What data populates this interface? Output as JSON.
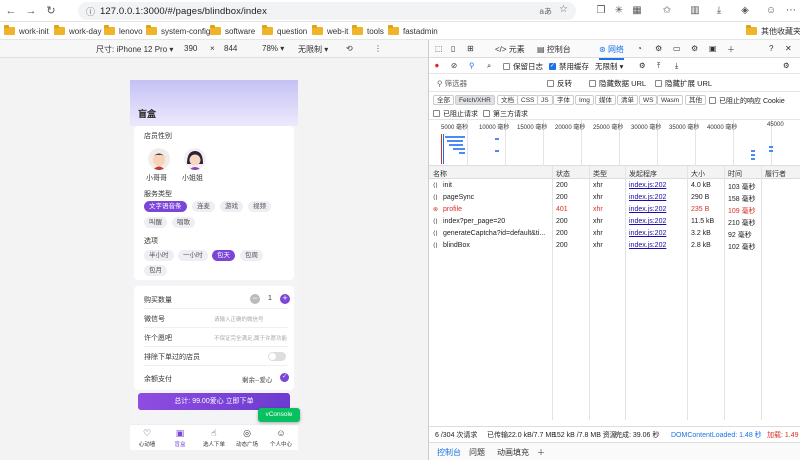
{
  "browser": {
    "url": "127.0.0.1:3000/#/pages/blindbox/index",
    "translate": "aあ",
    "bookmarks": [
      "work-init",
      "work-day",
      "lenovo",
      "system-config",
      "software",
      "question",
      "web-it",
      "tools",
      "fastadmin"
    ],
    "other_bookmarks": "其他收藏夹"
  },
  "device_toolbar": {
    "size_label": "尺寸: iPhone 12 Pro ▾",
    "width": "390",
    "x": "×",
    "height": "844",
    "zoom": "78% ▾",
    "throttle": "无限制 ▾"
  },
  "app": {
    "title": "盲盒",
    "gender_section": "店员性别",
    "genders": [
      {
        "label": "小哥哥"
      },
      {
        "label": "小姐姐"
      }
    ],
    "service_section": "服务类型",
    "services": [
      "文字语音条",
      "连麦",
      "游戏",
      "视频",
      "叫醒",
      "唱歌"
    ],
    "option_section": "选项",
    "options": [
      "半小时",
      "一小时",
      "包天",
      "包周",
      "包月"
    ],
    "quantity_label": "购买数量",
    "quantity_value": "1",
    "wechat_label": "微信号",
    "wechat_placeholder": "请输入正确的微信号",
    "note_label": "许个愿吧",
    "note_placeholder": "不保证完全满足,属于许愿功能",
    "exclude_label": "排除下单过的店员",
    "balance_label": "余额支付",
    "balance_value": "剩余--爱心",
    "order_button": "总计: 99.00爱心 立即下单",
    "vconsole": "vConsole",
    "tabs": [
      {
        "label": "心动墙",
        "icon": "♡"
      },
      {
        "label": "盲盒",
        "icon": "▣"
      },
      {
        "label": "选人下单",
        "icon": "☝"
      },
      {
        "label": "动态广场",
        "icon": "◎"
      },
      {
        "label": "个人中心",
        "icon": "☺"
      }
    ]
  },
  "devtools": {
    "tabs": [
      "元素",
      "控制台",
      "网络"
    ],
    "active_tab": "网络",
    "toolbar": {
      "preserve_log": "保留日志",
      "disable_cache": "禁用缓存",
      "throttle": "无限制"
    },
    "filter": {
      "placeholder": "筛选器",
      "invert": "反转",
      "hide_data_urls": "隐藏数据 URL",
      "hide_extension_urls": "隐藏扩展 URL"
    },
    "types": [
      "全部",
      "Fetch/XHR",
      "文档",
      "CSS",
      "JS",
      "字体",
      "Img",
      "媒体",
      "清单",
      "WS",
      "Wasm",
      "其他"
    ],
    "active_type": "Fetch/XHR",
    "blocked_cookies": "已阻止的响应 Cookie",
    "blocked_requests": "已阻止请求",
    "third_party": "第三方请求",
    "timeline_ticks": [
      "5000 毫秒",
      "10000 毫秒",
      "15000 毫秒",
      "20000 毫秒",
      "25000 毫秒",
      "30000 毫秒",
      "35000 毫秒",
      "40000 毫秒",
      "45000"
    ],
    "columns": [
      "名称",
      "状态",
      "类型",
      "发起程序",
      "大小",
      "时间",
      "履行者"
    ],
    "rows": [
      {
        "name": "init",
        "status": "200",
        "type": "xhr",
        "initiator": "index.js:202",
        "size": "4.0 kB",
        "time": "103 毫秒",
        "error": false
      },
      {
        "name": "pageSync",
        "status": "200",
        "type": "xhr",
        "initiator": "index.js:202",
        "size": "290 B",
        "time": "158 毫秒",
        "error": false
      },
      {
        "name": "profile",
        "status": "401",
        "type": "xhr",
        "initiator": "index.js:202",
        "size": "235 B",
        "time": "109 毫秒",
        "error": true
      },
      {
        "name": "index?per_page=20",
        "status": "200",
        "type": "xhr",
        "initiator": "index.js:202",
        "size": "11.5 kB",
        "time": "210 毫秒",
        "error": false
      },
      {
        "name": "generateCaptcha?id=default&ti...",
        "status": "200",
        "type": "xhr",
        "initiator": "index.js:202",
        "size": "3.2 kB",
        "time": "92 毫秒",
        "error": false
      },
      {
        "name": "blindBox",
        "status": "200",
        "type": "xhr",
        "initiator": "index.js:202",
        "size": "2.8 kB",
        "time": "102 毫秒",
        "error": false
      }
    ],
    "status": {
      "requests": "6 /304 次请求",
      "transferred": "已传输22.0 kB/7.7 MB",
      "resources": "152 kB /7.8 MB 资源",
      "finish": "完成: 39.06 秒",
      "dcl": "DOMContentLoaded: 1.48 秒",
      "load": "加载: 1.49"
    },
    "drawer_tabs": [
      "控制台",
      "问题",
      "动画填充"
    ]
  }
}
